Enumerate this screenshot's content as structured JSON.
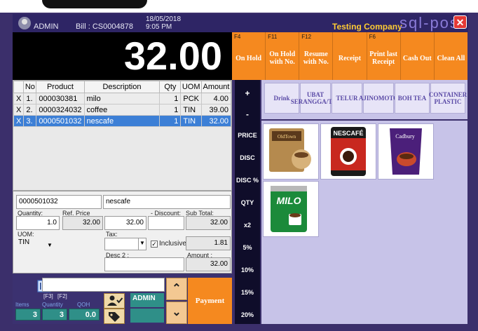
{
  "header": {
    "user": "ADMIN",
    "bill_label": "Bill : CS0004878",
    "date": "18/05/2018",
    "time": "9:05 PM",
    "company": "Testing Company",
    "brand": "sql-pos",
    "close_symbol": "✕"
  },
  "total": "32.00",
  "function_keys": [
    {
      "key": "F4",
      "label": "On Hold"
    },
    {
      "key": "F11",
      "label": "On Hold with No."
    },
    {
      "key": "F12",
      "label": "Resume with No."
    },
    {
      "key": "",
      "label": "Receipt"
    },
    {
      "key": "F6",
      "label": "Print last Receipt"
    },
    {
      "key": "",
      "label": "Cash Out"
    },
    {
      "key": "",
      "label": "Clean All"
    }
  ],
  "grid": {
    "headers": [
      "",
      "No",
      "Product",
      "Description",
      "Qty",
      "UOM",
      "Amount"
    ],
    "rows": [
      {
        "del": "X",
        "no": "1.",
        "product": "000030381",
        "desc": "milo",
        "qty": "1",
        "uom": "PCK",
        "amount": "4.00"
      },
      {
        "del": "X",
        "no": "2.",
        "product": "0000324032",
        "desc": "coffee",
        "qty": "1",
        "uom": "TIN",
        "amount": "39.00"
      },
      {
        "del": "X",
        "no": "3.",
        "product": "0000501032",
        "desc": "nescafe",
        "qty": "1",
        "uom": "TIN",
        "amount": "32.00"
      }
    ]
  },
  "detail": {
    "code": "0000501032",
    "desc": "nescafe",
    "quantity_label": "Quantity:",
    "quantity": "1.0",
    "refprice_label": "Ref. Price",
    "refprice": "32.00",
    "price": "32.00",
    "discount_label": "- Discount:",
    "discount": "",
    "subtotal_label": "Sub Total:",
    "subtotal": "32.00",
    "uom_label": "UOM:",
    "uom": "TIN",
    "tax_label": "Tax:",
    "tax": "",
    "inclusive_label": "Inclusive",
    "tax_amount": "1.81",
    "desc2_label": "Desc 2 :",
    "amount_label": "Amount :",
    "amount": "32.00"
  },
  "bottom": {
    "f3": "[F3]",
    "f2": "[F2]",
    "items_label": "Items",
    "quantity_label": "Quantity",
    "qoh_label": "QOH",
    "items": "3",
    "quantity": "3",
    "qoh": "0.0",
    "admin": "ADMIN",
    "payment": "Payment"
  },
  "side_keys": [
    "+",
    "-",
    "PRICE",
    "DISC",
    "DISC %",
    "QTY",
    "x2",
    "5%",
    "10%",
    "15%",
    "20%"
  ],
  "categories": [
    "Drink",
    "UBAT SERANGGA/TST",
    "TELUR",
    "AJINOMOTO",
    "BOH TEA",
    "CONTAINER PLASTIC"
  ],
  "products": [
    {
      "name": "OldTown White Coffee",
      "label": "OldTown"
    },
    {
      "name": "Nescafe Original",
      "label": "NESCAFÉ"
    },
    {
      "name": "Cadbury Chocolate Drink",
      "label": "Cadbury"
    },
    {
      "name": "Milo",
      "label": "MILO"
    }
  ],
  "colors": {
    "frame": "#3b2f6b",
    "accent_orange": "#f5891f",
    "teal": "#2f8f88",
    "selection": "#3c7fd6"
  }
}
